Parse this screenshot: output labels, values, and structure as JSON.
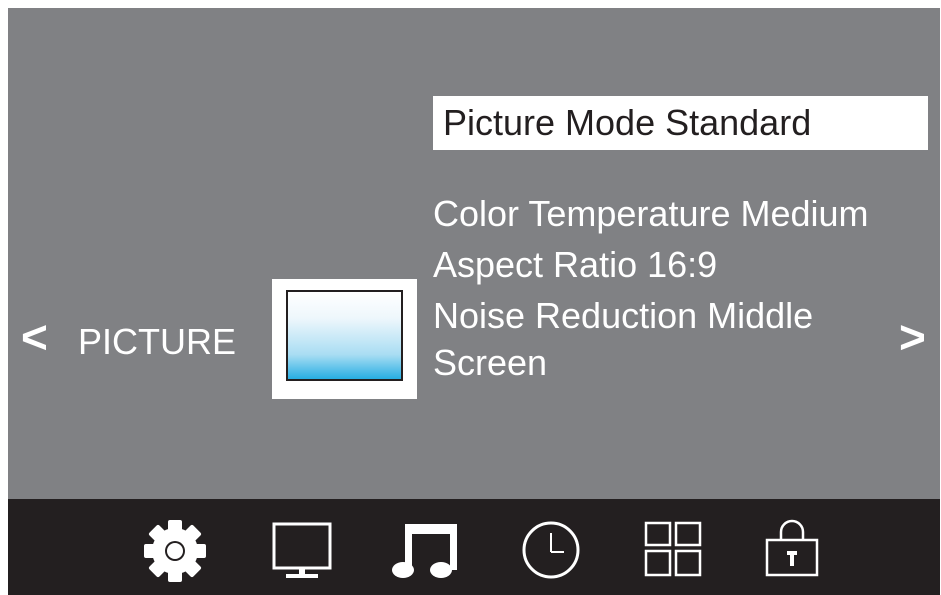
{
  "category": {
    "prev_arrow": "<",
    "label": "PICTURE",
    "next_arrow": ">"
  },
  "menu": {
    "items": [
      {
        "label": "Picture Mode Standard",
        "selected": true
      },
      {
        "label": "Color Temperature Medium",
        "selected": false
      },
      {
        "label": "Aspect Ratio 16:9",
        "selected": false
      },
      {
        "label": "Noise Reduction Middle",
        "selected": false
      },
      {
        "label": "Screen",
        "selected": false
      }
    ]
  },
  "bottom_nav": {
    "icons": [
      "gear-icon",
      "monitor-icon",
      "music-note-icon",
      "clock-icon",
      "grid-icon",
      "lock-icon"
    ],
    "active": "gear-icon"
  },
  "colors": {
    "background": "#808184",
    "bottom_bar": "#231f20",
    "selected_bg": "#ffffff",
    "text": "#ffffff",
    "thumbnail_accent": "#27aee3"
  }
}
